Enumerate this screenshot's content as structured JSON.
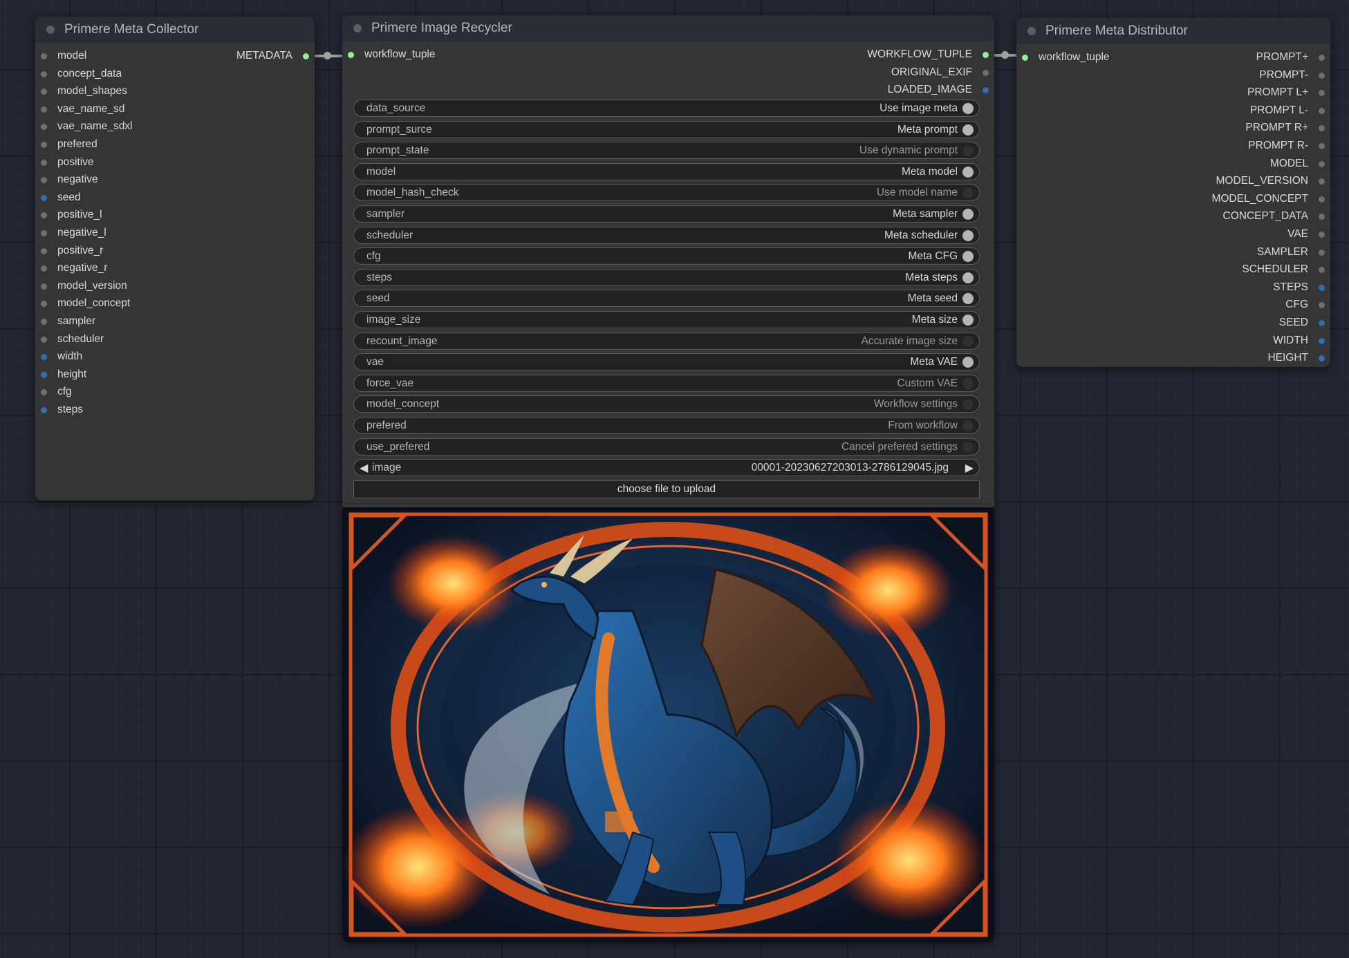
{
  "collector": {
    "title": "Primere Meta Collector",
    "inputs": [
      {
        "label": "model",
        "color": "grey"
      },
      {
        "label": "concept_data",
        "color": "grey"
      },
      {
        "label": "model_shapes",
        "color": "grey"
      },
      {
        "label": "vae_name_sd",
        "color": "grey"
      },
      {
        "label": "vae_name_sdxl",
        "color": "grey"
      },
      {
        "label": "prefered",
        "color": "grey"
      },
      {
        "label": "positive",
        "color": "grey"
      },
      {
        "label": "negative",
        "color": "grey"
      },
      {
        "label": "seed",
        "color": "blue"
      },
      {
        "label": "positive_l",
        "color": "grey"
      },
      {
        "label": "negative_l",
        "color": "grey"
      },
      {
        "label": "positive_r",
        "color": "grey"
      },
      {
        "label": "negative_r",
        "color": "grey"
      },
      {
        "label": "model_version",
        "color": "grey"
      },
      {
        "label": "model_concept",
        "color": "grey"
      },
      {
        "label": "sampler",
        "color": "grey"
      },
      {
        "label": "scheduler",
        "color": "grey"
      },
      {
        "label": "width",
        "color": "blue"
      },
      {
        "label": "height",
        "color": "blue"
      },
      {
        "label": "cfg",
        "color": "grey"
      },
      {
        "label": "steps",
        "color": "blue"
      }
    ],
    "output": "METADATA"
  },
  "recycler": {
    "title": "Primere Image Recycler",
    "input": "workflow_tuple",
    "outputs": [
      {
        "label": "WORKFLOW_TUPLE",
        "color": "green"
      },
      {
        "label": "ORIGINAL_EXIF",
        "color": "grey"
      },
      {
        "label": "LOADED_IMAGE",
        "color": "blue"
      }
    ],
    "widgets": [
      {
        "name": "data_source",
        "value": "Use image meta",
        "state": "on"
      },
      {
        "name": "prompt_surce",
        "value": "Meta prompt",
        "state": "on"
      },
      {
        "name": "prompt_state",
        "value": "Use dynamic prompt",
        "state": "off"
      },
      {
        "name": "model",
        "value": "Meta model",
        "state": "on"
      },
      {
        "name": "model_hash_check",
        "value": "Use model name",
        "state": "off"
      },
      {
        "name": "sampler",
        "value": "Meta sampler",
        "state": "on"
      },
      {
        "name": "scheduler",
        "value": "Meta scheduler",
        "state": "on"
      },
      {
        "name": "cfg",
        "value": "Meta CFG",
        "state": "on"
      },
      {
        "name": "steps",
        "value": "Meta steps",
        "state": "on"
      },
      {
        "name": "seed",
        "value": "Meta seed",
        "state": "on"
      },
      {
        "name": "image_size",
        "value": "Meta size",
        "state": "on"
      },
      {
        "name": "recount_image",
        "value": "Accurate image size",
        "state": "off"
      },
      {
        "name": "vae",
        "value": "Meta VAE",
        "state": "on"
      },
      {
        "name": "force_vae",
        "value": "Custom VAE",
        "state": "off"
      },
      {
        "name": "model_concept",
        "value": "Workflow settings",
        "state": "off"
      },
      {
        "name": "prefered",
        "value": "From workflow",
        "state": "off"
      },
      {
        "name": "use_prefered",
        "value": "Cancel prefered settings",
        "state": "off"
      }
    ],
    "image_combo": {
      "name": "image",
      "value": "00001-20230627203013-2786129045.jpg",
      "left_arrow": "◀",
      "right_arrow": "▶"
    },
    "upload_label": "choose file to upload"
  },
  "distributor": {
    "title": "Primere Meta Distributor",
    "input": "workflow_tuple",
    "outputs": [
      {
        "label": "PROMPT+",
        "color": "grey"
      },
      {
        "label": "PROMPT-",
        "color": "grey"
      },
      {
        "label": "PROMPT L+",
        "color": "grey"
      },
      {
        "label": "PROMPT L-",
        "color": "grey"
      },
      {
        "label": "PROMPT R+",
        "color": "grey"
      },
      {
        "label": "PROMPT R-",
        "color": "grey"
      },
      {
        "label": "MODEL",
        "color": "grey"
      },
      {
        "label": "MODEL_VERSION",
        "color": "grey"
      },
      {
        "label": "MODEL_CONCEPT",
        "color": "grey"
      },
      {
        "label": "CONCEPT_DATA",
        "color": "grey"
      },
      {
        "label": "VAE",
        "color": "grey"
      },
      {
        "label": "SAMPLER",
        "color": "grey"
      },
      {
        "label": "SCHEDULER",
        "color": "grey"
      },
      {
        "label": "STEPS",
        "color": "blue"
      },
      {
        "label": "CFG",
        "color": "grey"
      },
      {
        "label": "SEED",
        "color": "blue"
      },
      {
        "label": "WIDTH",
        "color": "blue"
      },
      {
        "label": "HEIGHT",
        "color": "blue"
      }
    ]
  },
  "colors": {
    "slot_grey": "#6b6e76",
    "slot_blue": "#2f6fb0",
    "slot_green": "#8ef28e",
    "node_bg": "#353535",
    "header_bg": "#2a2d36"
  }
}
